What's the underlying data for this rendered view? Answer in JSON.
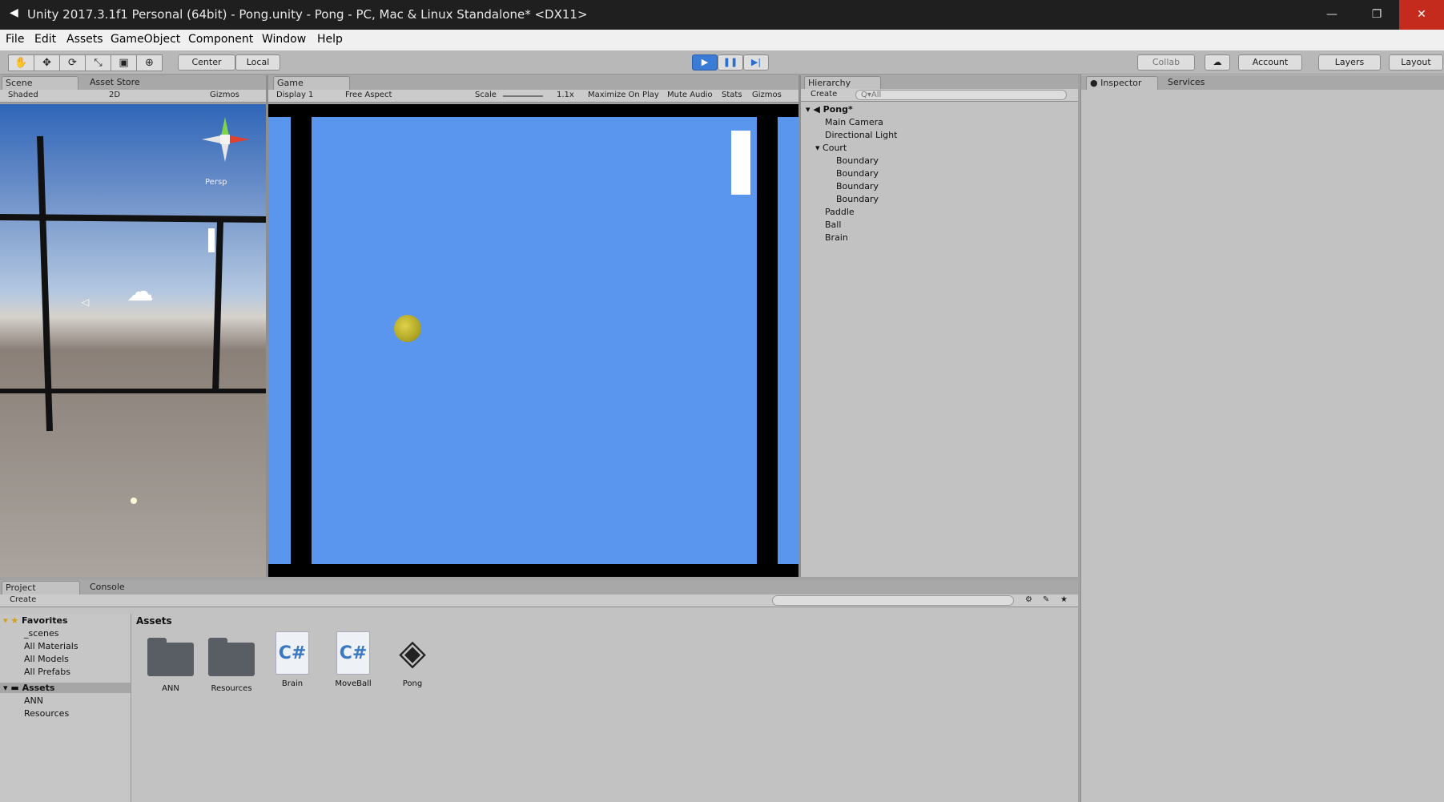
{
  "window": {
    "title": "Unity 2017.3.1f1 Personal (64bit) - Pong.unity - Pong - PC, Mac & Linux Standalone* <DX11>",
    "minimize": "—",
    "maximize": "❐",
    "close": "✕"
  },
  "menu": [
    "File",
    "Edit",
    "Assets",
    "GameObject",
    "Component",
    "Window",
    "Help"
  ],
  "toolbar": {
    "tools": [
      "✋",
      "✥",
      "⟳",
      "⤡",
      "▣",
      "⊕"
    ],
    "pivot": "Center",
    "space": "Local",
    "play": "▶",
    "pause": "❚❚",
    "step": "▶|",
    "collab": "Collab",
    "cloud": "☁",
    "account": "Account",
    "layers": "Layers",
    "layout": "Layout"
  },
  "scene": {
    "tab_scene": "Scene",
    "tab_asset_store": "Asset Store",
    "shading": "Shaded",
    "mode2d": "2D",
    "gizmos": "Gizmos",
    "persp": "Persp"
  },
  "game": {
    "tab": "Game",
    "display": "Display 1",
    "aspect": "Free Aspect",
    "scale_label": "Scale",
    "scale_value": "1.1x",
    "maximize": "Maximize On Play",
    "mute": "Mute Audio",
    "stats": "Stats",
    "gizmos": "Gizmos",
    "bg_color": "#5b96ee"
  },
  "hierarchy": {
    "tab": "Hierarchy",
    "create": "Create",
    "search_placeholder": "Q▾All",
    "scene": "Pong*",
    "items": [
      "Main Camera",
      "Directional Light",
      "Court",
      "Boundary",
      "Boundary",
      "Boundary",
      "Boundary",
      "Paddle",
      "Ball",
      "Brain"
    ]
  },
  "inspector": {
    "tab_inspector": "Inspector",
    "tab_services": "Services"
  },
  "project": {
    "tab_project": "Project",
    "tab_console": "Console",
    "create": "Create",
    "breadcrumb": "Assets",
    "favorites": "Favorites",
    "fav_items": [
      "_scenes",
      "All Materials",
      "All Models",
      "All Prefabs"
    ],
    "assets_root": "Assets",
    "asset_folders": [
      "ANN",
      "Resources"
    ],
    "assets": [
      "ANN",
      "Resources",
      "Brain",
      "MoveBall",
      "Pong"
    ]
  }
}
